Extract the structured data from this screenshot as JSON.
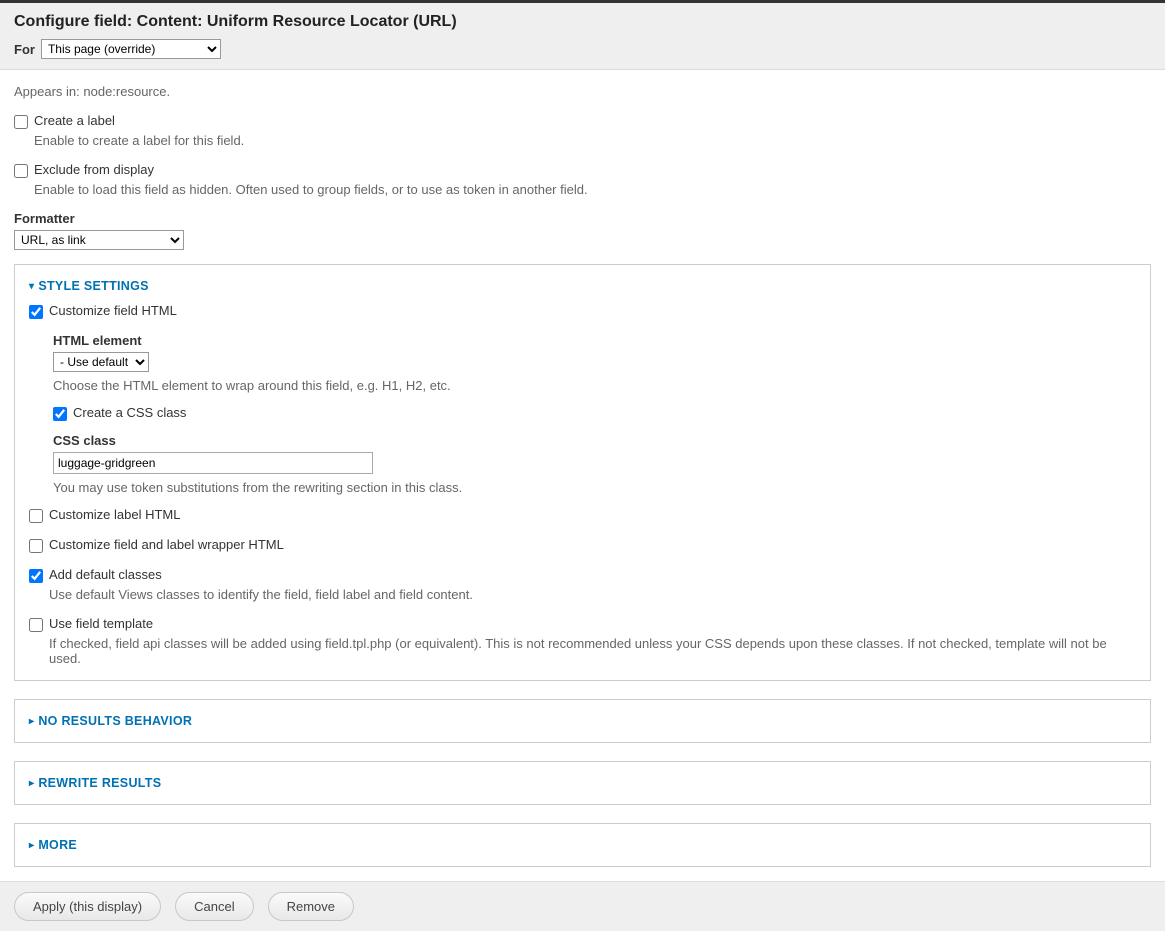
{
  "header": {
    "title": "Configure field: Content: Uniform Resource Locator (URL)",
    "for_label": "For",
    "for_value": "This page (override)"
  },
  "appears_in": "Appears in: node:resource.",
  "create_label": {
    "label": "Create a label",
    "description": "Enable to create a label for this field."
  },
  "exclude_display": {
    "label": "Exclude from display",
    "description": "Enable to load this field as hidden. Often used to group fields, or to use as token in another field."
  },
  "formatter": {
    "label": "Formatter",
    "value": "URL, as link"
  },
  "style_settings": {
    "legend": "Style Settings",
    "customize_field_html": "Customize field HTML",
    "html_element_label": "HTML element",
    "html_element_value": "- Use default -",
    "html_element_desc": "Choose the HTML element to wrap around this field, e.g. H1, H2, etc.",
    "create_css_class": "Create a CSS class",
    "css_class_label": "CSS class",
    "css_class_value": "luggage-gridgreen",
    "css_class_desc": "You may use token substitutions from the rewriting section in this class.",
    "customize_label_html": "Customize label HTML",
    "customize_wrapper_html": "Customize field and label wrapper HTML",
    "add_default_classes": "Add default classes",
    "add_default_classes_desc": "Use default Views classes to identify the field, field label and field content.",
    "use_field_template": "Use field template",
    "use_field_template_desc": "If checked, field api classes will be added using field.tpl.php (or equivalent). This is not recommended unless your CSS depends upon these classes. If not checked, template will not be used."
  },
  "no_results": {
    "legend": "No Results Behavior"
  },
  "rewrite": {
    "legend": "Rewrite Results"
  },
  "more": {
    "legend": "More"
  },
  "buttons": {
    "apply": "Apply (this display)",
    "cancel": "Cancel",
    "remove": "Remove"
  }
}
